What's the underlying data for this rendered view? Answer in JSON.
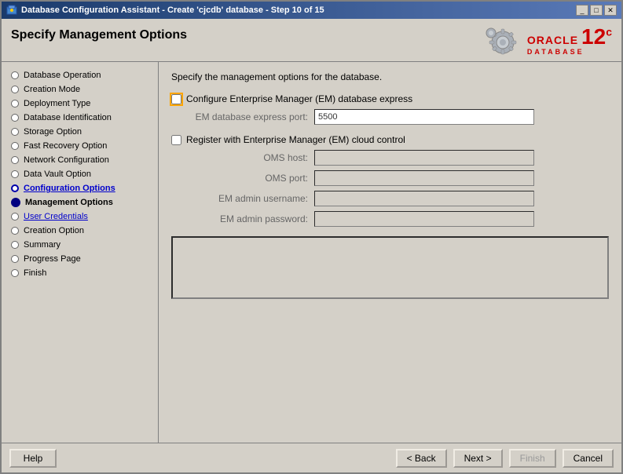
{
  "window": {
    "title": "Database Configuration Assistant - Create 'cjcdb' database - Step 10 of 15",
    "minimize_label": "_",
    "maximize_label": "□",
    "close_label": "✕"
  },
  "header": {
    "title": "Specify Management Options",
    "oracle_text": "ORACLE",
    "database_text": "DATABASE",
    "version": "12",
    "version_suffix": "c"
  },
  "sidebar": {
    "items": [
      {
        "id": "database-operation",
        "label": "Database Operation",
        "state": "visited"
      },
      {
        "id": "creation-mode",
        "label": "Creation Mode",
        "state": "visited"
      },
      {
        "id": "deployment-type",
        "label": "Deployment Type",
        "state": "visited"
      },
      {
        "id": "database-identification",
        "label": "Database Identification",
        "state": "visited"
      },
      {
        "id": "storage-option",
        "label": "Storage Option",
        "state": "visited"
      },
      {
        "id": "fast-recovery-option",
        "label": "Fast Recovery Option",
        "state": "visited"
      },
      {
        "id": "network-configuration",
        "label": "Network Configuration",
        "state": "visited"
      },
      {
        "id": "data-vault-option",
        "label": "Data Vault Option",
        "state": "visited"
      },
      {
        "id": "configuration-options",
        "label": "Configuration Options",
        "state": "prev-active"
      },
      {
        "id": "management-options",
        "label": "Management Options",
        "state": "current"
      },
      {
        "id": "user-credentials",
        "label": "User Credentials",
        "state": "linked"
      },
      {
        "id": "creation-option",
        "label": "Creation Option",
        "state": "future"
      },
      {
        "id": "summary",
        "label": "Summary",
        "state": "future"
      },
      {
        "id": "progress-page",
        "label": "Progress Page",
        "state": "future"
      },
      {
        "id": "finish",
        "label": "Finish",
        "state": "future"
      }
    ]
  },
  "content": {
    "description": "Specify the management options for the database.",
    "em_express": {
      "checkbox_label": "Configure Enterprise Manager (EM) database express",
      "port_label": "EM database express port:",
      "port_value": "5500",
      "checked": false
    },
    "em_cloud": {
      "checkbox_label": "Register with Enterprise Manager (EM) cloud control",
      "checked": false,
      "oms_host_label": "OMS host:",
      "oms_host_value": "",
      "oms_port_label": "OMS port:",
      "oms_port_value": "",
      "em_admin_user_label": "EM admin username:",
      "em_admin_user_value": "",
      "em_admin_pass_label": "EM admin password:",
      "em_admin_pass_value": ""
    }
  },
  "buttons": {
    "help": "Help",
    "back": "< Back",
    "next": "Next >",
    "finish": "Finish",
    "cancel": "Cancel"
  }
}
